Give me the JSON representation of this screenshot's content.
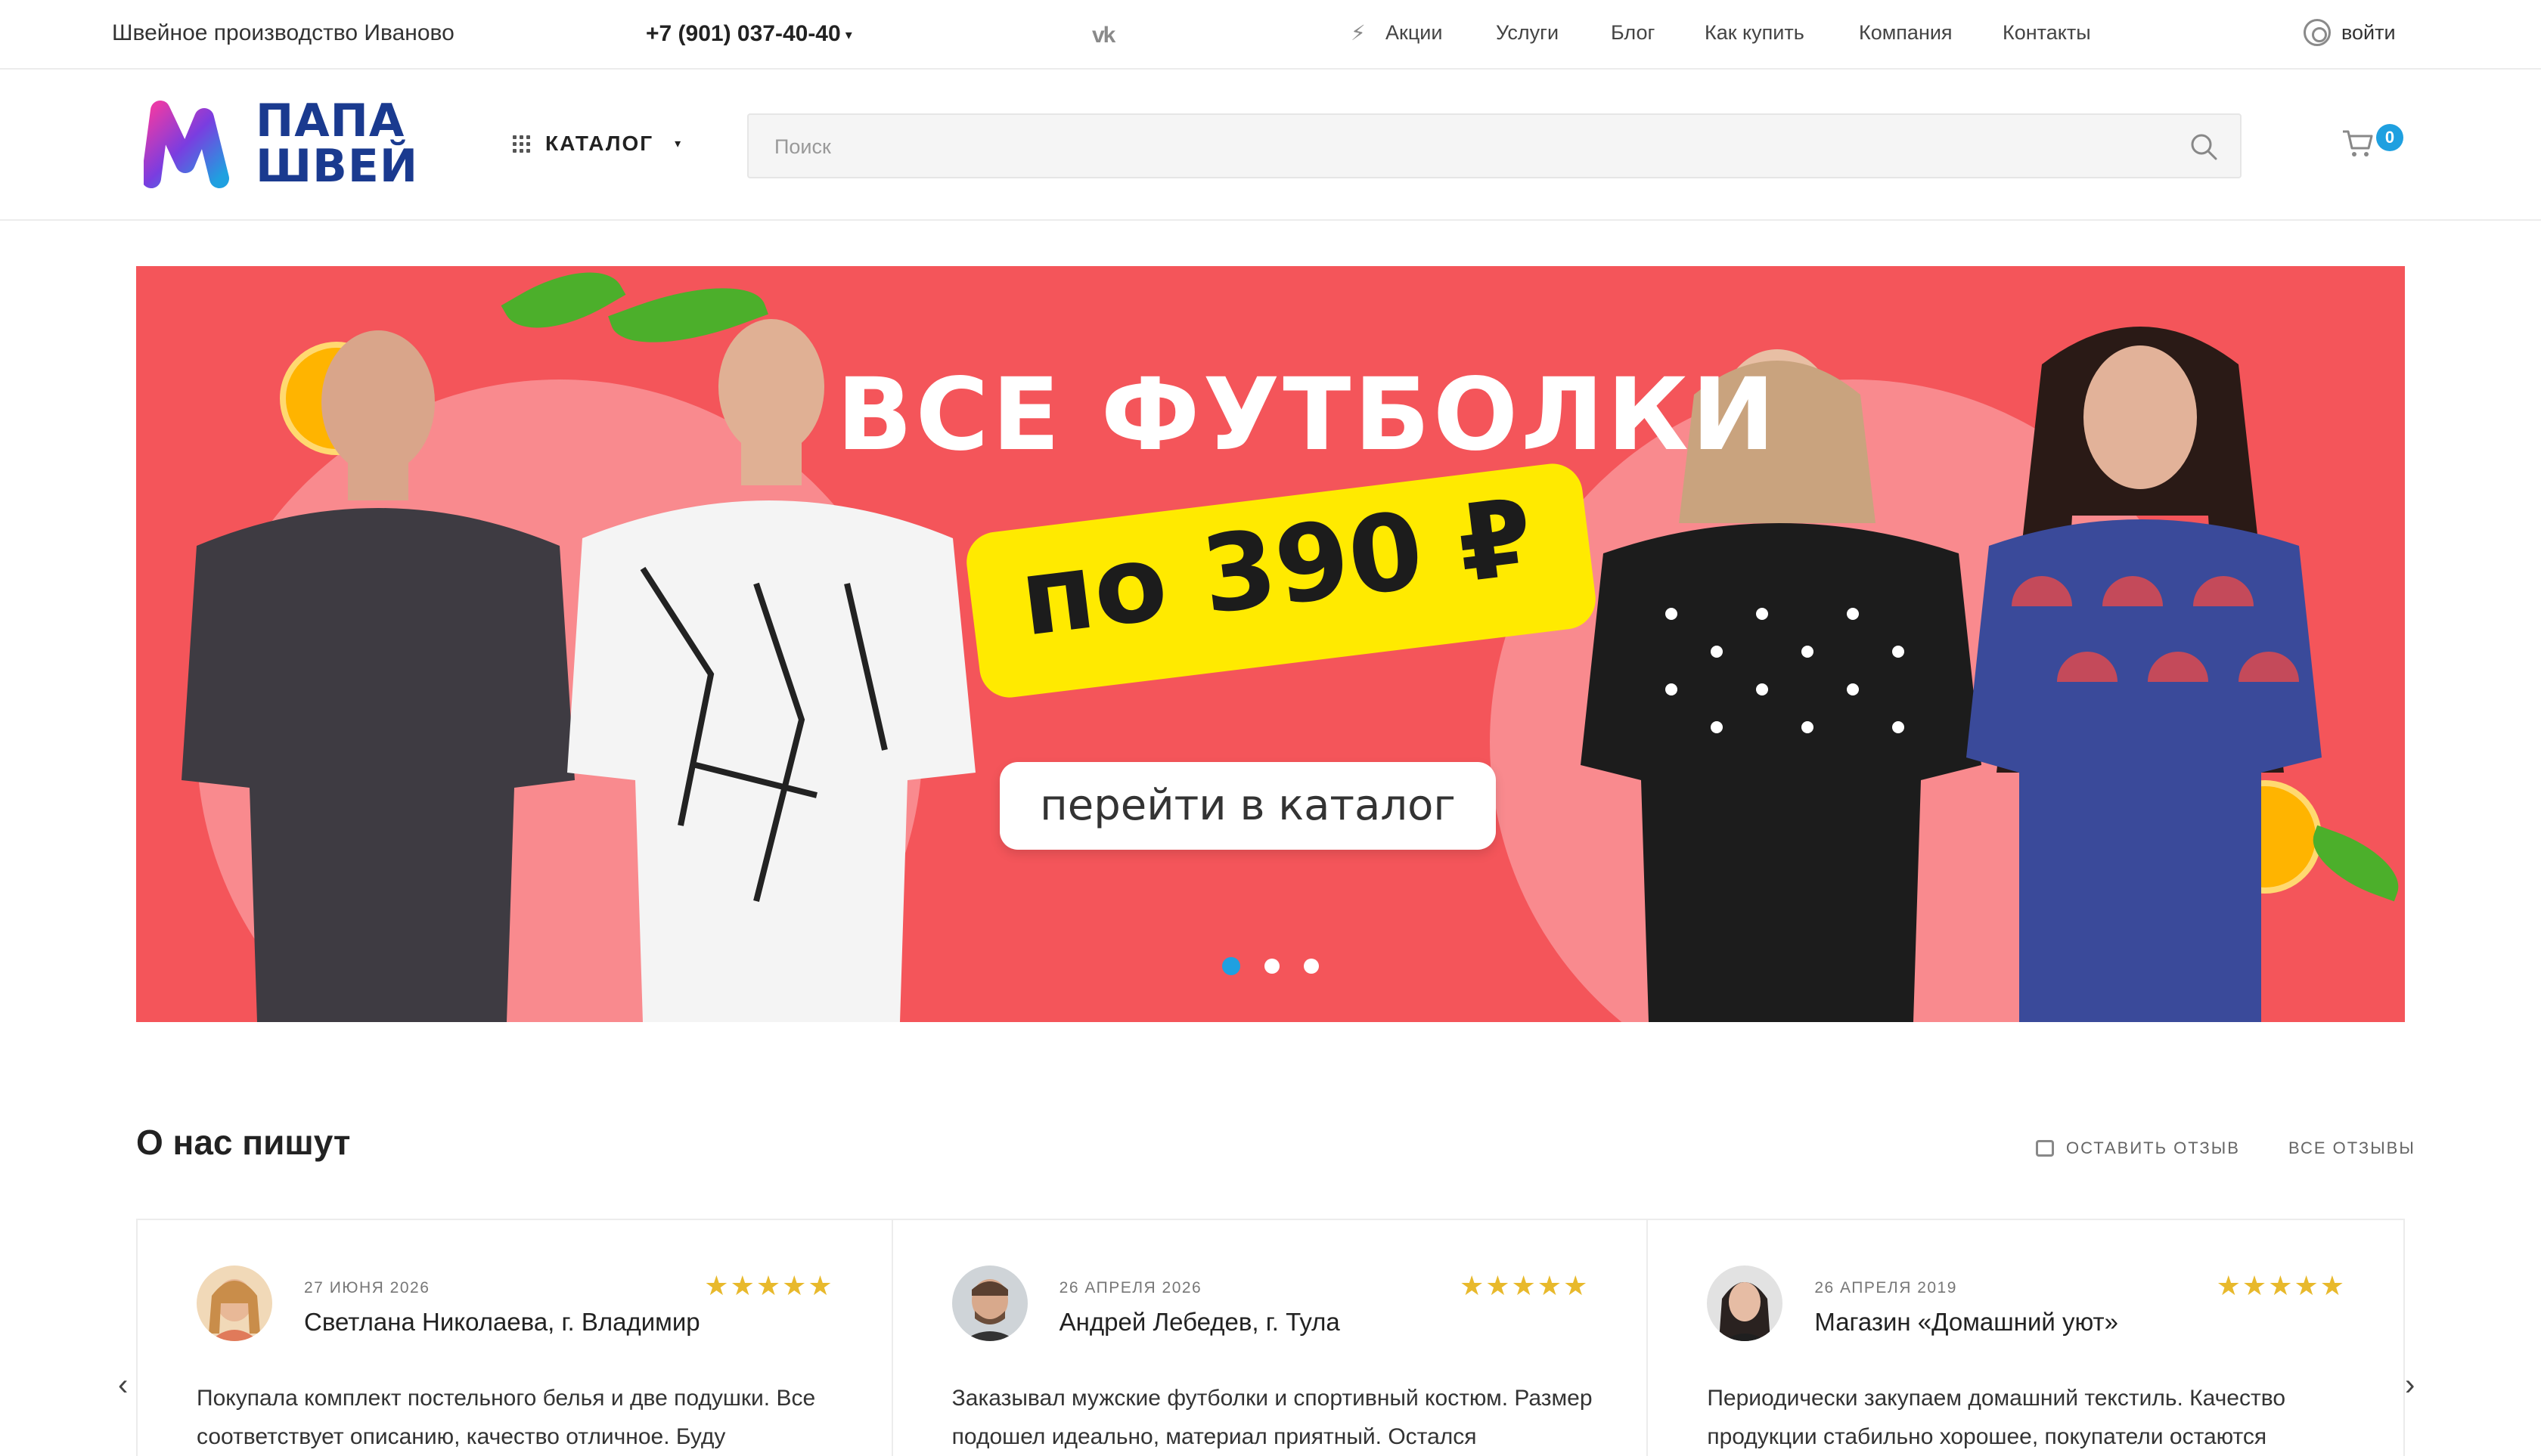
{
  "topbar": {
    "company": "Швейное производство Иваново",
    "phone": "+7 (901) 037-40-40",
    "social": "vk",
    "nav": [
      "Акции",
      "Услуги",
      "Блог",
      "Как купить",
      "Компания",
      "Контакты"
    ],
    "login": "войти"
  },
  "header": {
    "logo_line1": "ПАПА",
    "logo_line2": "ШВЕЙ",
    "catalog_label": "КАТАЛОГ",
    "search_placeholder": "Поиск",
    "cart_count": "0"
  },
  "banner": {
    "headline": "ВСЕ ФУТБОЛКИ",
    "price": "по 390 ₽",
    "cta": "перейти в каталог",
    "slides_total": 3,
    "active_slide": 1
  },
  "reviews": {
    "title": "О нас пишут",
    "leave_review": "ОСТАВИТЬ ОТЗЫВ",
    "all_reviews": "ВСЕ ОТЗЫВЫ",
    "items": [
      {
        "date": "27 июня 2026",
        "name": "Светлана Николаева, г. Владимир",
        "rating": 5,
        "stars": "★★★★★",
        "text": "Покупала комплект постельного белья и две подушки. Все соответствует описанию, качество отличное. Буду"
      },
      {
        "date": "26 апреля 2026",
        "name": "Андрей Лебедев, г. Тула",
        "rating": 5,
        "stars": "★★★★★",
        "text": "Заказывал мужские футболки и спортивный костюм. Размер подошел идеально, материал приятный. Остался"
      },
      {
        "date": "26 апреля 2019",
        "name": "Магазин «Домашний уют»",
        "rating": 5,
        "stars": "★★★★★",
        "text": "Периодически закупаем домашний текстиль. Качество продукции стабильно хорошее, покупатели остаются"
      }
    ]
  },
  "colors": {
    "accent": "#1fa0e0",
    "banner_bg": "#f4555a",
    "price_bg": "#ffea00",
    "star": "#e8b92c",
    "logo_text": "#1a3a8f"
  }
}
